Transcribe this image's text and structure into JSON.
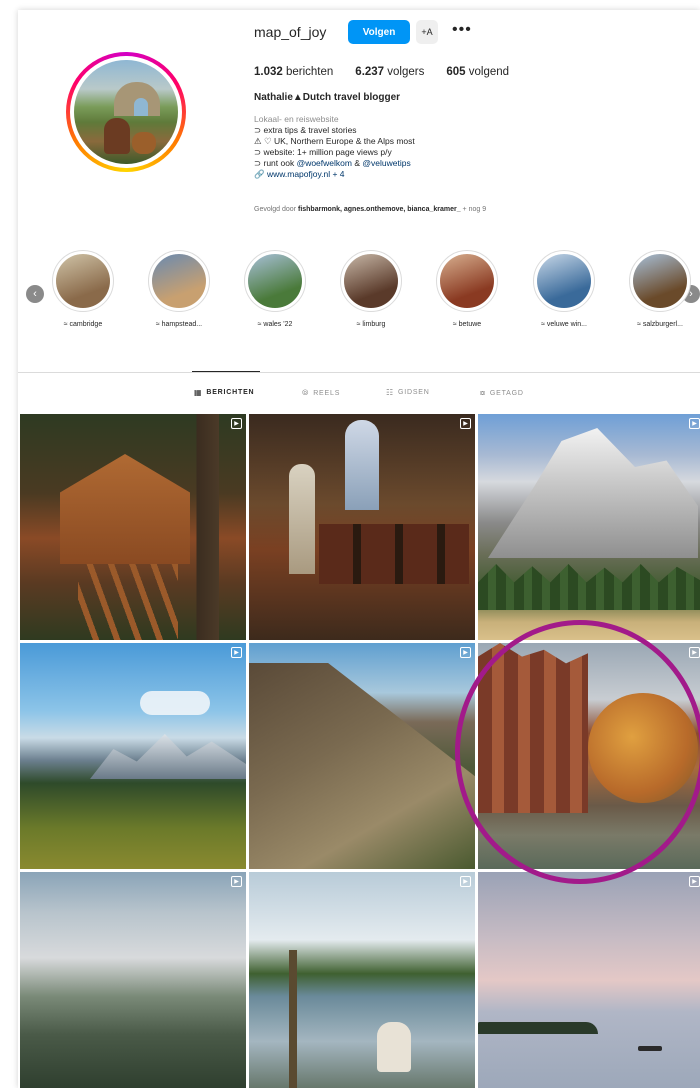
{
  "profile": {
    "username": "map_of_joy",
    "follow_label": "Volgen",
    "suggest_label": "+A",
    "more_label": "•••",
    "stats": [
      {
        "value": "1.032",
        "label": "berichten"
      },
      {
        "value": "6.237",
        "label": "volgers"
      },
      {
        "value": "605",
        "label": "volgend"
      }
    ],
    "fullname": "Nathalie▲Dutch travel blogger",
    "bio": {
      "category": "Lokaal- en reiswebsite",
      "lines": [
        "⊃ extra tips & travel stories",
        "⚠ ♡ UK, Northern Europe & the Alps most",
        "⊃ website: 1+ million page views p/y"
      ],
      "runs_prefix": "⊃ runt ook ",
      "mention1": "@woefwelkom",
      "mention_sep": " & ",
      "mention2": "@veluwetips",
      "link": "🔗 www.mapofjoy.nl + 4"
    },
    "followed_by_prefix": "Gevolgd door ",
    "followed_by_names": "fishbarmonk, agnes.onthemove, bianca_kramer_",
    "followed_by_suffix": " + nog 9"
  },
  "highlights": [
    {
      "label": "≈ cambridge",
      "color1": "#8a6a4a",
      "color2": "#d0c4a8"
    },
    {
      "label": "≈ hampstead...",
      "color1": "#c8a070",
      "color2": "#6a8ab0"
    },
    {
      "label": "≈ wales '22",
      "color1": "#4a7a3a",
      "color2": "#a8c0d8"
    },
    {
      "label": "≈ limburg",
      "color1": "#5a3a2a",
      "color2": "#c8b8a8"
    },
    {
      "label": "≈ betuwe",
      "color1": "#8a3a22",
      "color2": "#d8b090"
    },
    {
      "label": "≈ veluwe win...",
      "color1": "#3a6a9a",
      "color2": "#c8d8e8"
    },
    {
      "label": "≈ salzburgerl...",
      "color1": "#6a4a2a",
      "color2": "#a8c0d8"
    }
  ],
  "tabs": [
    {
      "icon": "▦",
      "label": "BERICHTEN",
      "active": true
    },
    {
      "icon": "⦾",
      "label": "REELS",
      "active": false
    },
    {
      "icon": "☷",
      "label": "GIDSEN",
      "active": false
    },
    {
      "icon": "⧇",
      "label": "GETAGD",
      "active": false
    }
  ],
  "posts": [
    {
      "reel": true
    },
    {
      "reel": true
    },
    {
      "reel": true
    },
    {
      "reel": true
    },
    {
      "reel": true
    },
    {
      "reel": true
    },
    {
      "reel": true
    },
    {
      "reel": true
    },
    {
      "reel": true
    }
  ],
  "colors": {
    "accent": "#0095f6",
    "annotation": "#a21a8a"
  }
}
